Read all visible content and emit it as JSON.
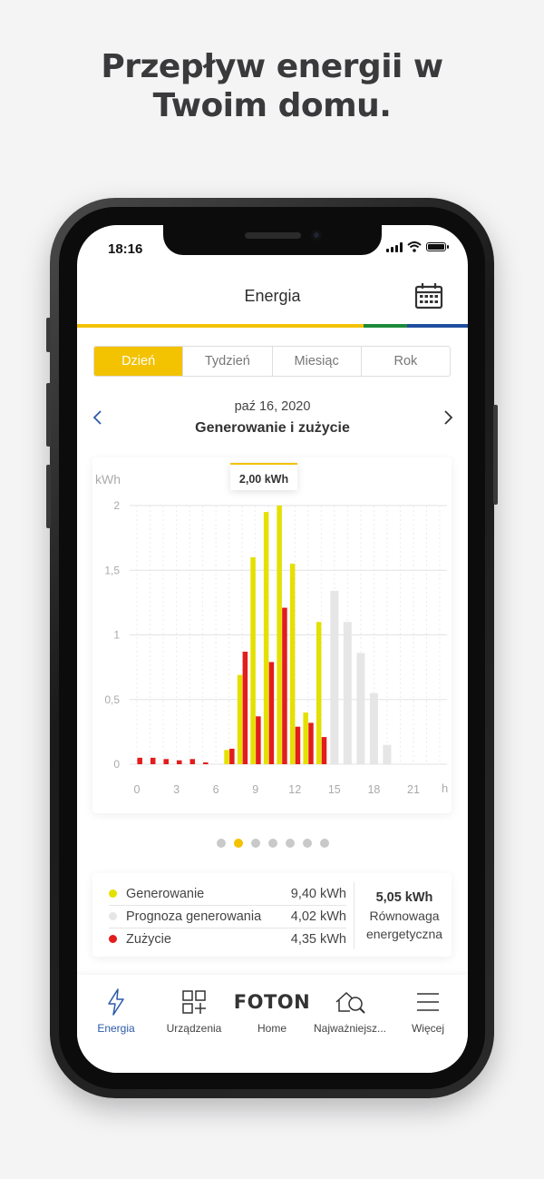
{
  "headline": {
    "line1": "Przepływ energii w",
    "line2": "Twoim domu."
  },
  "status": {
    "time": "18:16"
  },
  "header": {
    "title": "Energia",
    "calendar_icon": "calendar-icon"
  },
  "colors": {
    "accent": "#f3c200",
    "generation": "#e4e000",
    "forecast": "#e6e6e6",
    "consumption": "#e31c1c",
    "active_tab": "#2a5aa8"
  },
  "periods": [
    {
      "label": "Dzień",
      "selected": true
    },
    {
      "label": "Tydzień",
      "selected": false
    },
    {
      "label": "Miesiąc",
      "selected": false
    },
    {
      "label": "Rok",
      "selected": false
    }
  ],
  "day": {
    "date": "paź 16, 2020",
    "title": "Generowanie i zużycie"
  },
  "tooltip": {
    "value": "2,00 kWh"
  },
  "chart_data": {
    "type": "bar",
    "ylabel": "kWh",
    "xlabel": "h",
    "ylim": [
      0,
      2
    ],
    "xlim": [
      0,
      23
    ],
    "yticks": [
      "0",
      "0,5",
      "1",
      "1,5",
      "2"
    ],
    "xticks": [
      "0",
      "3",
      "6",
      "9",
      "12",
      "15",
      "18",
      "21"
    ],
    "grid": true,
    "series": [
      {
        "name": "Generowanie",
        "x": [
          7,
          8,
          9,
          10,
          11,
          12,
          13,
          14
        ],
        "values": [
          0.11,
          0.69,
          1.6,
          1.95,
          2.0,
          1.55,
          0.4,
          1.1
        ]
      },
      {
        "name": "Prognoza generowania",
        "x": [
          15,
          16,
          17,
          18,
          19
        ],
        "values": [
          1.34,
          1.1,
          0.86,
          0.55,
          0.15
        ]
      },
      {
        "name": "Zużycie",
        "x": [
          0,
          1,
          2,
          3,
          4,
          5,
          6,
          7,
          8,
          9,
          10,
          11,
          12,
          13,
          14
        ],
        "values": [
          0.05,
          0.05,
          0.04,
          0.03,
          0.04,
          0.01,
          0.0,
          0.12,
          0.87,
          0.37,
          0.79,
          1.21,
          0.29,
          0.32,
          0.21
        ]
      }
    ]
  },
  "pager": {
    "count": 7,
    "active": 1
  },
  "summary": {
    "rows": [
      {
        "label": "Generowanie",
        "value": "9,40 kWh",
        "color": "#e4e000"
      },
      {
        "label": "Prognoza generowania",
        "value": "4,02 kWh",
        "color": "#e6e6e6"
      },
      {
        "label": "Zużycie",
        "value": "4,35 kWh",
        "color": "#e31c1c"
      }
    ],
    "balance_value": "5,05 kWh",
    "balance_label1": "Równowaga",
    "balance_label2": "energetyczna"
  },
  "tabs": [
    {
      "label": "Energia",
      "icon": "lightning-icon",
      "active": true
    },
    {
      "label": "Urządzenia",
      "icon": "devices-grid-icon",
      "active": false
    },
    {
      "label": "Home",
      "icon": "foton-logo",
      "logo_text": "FOTON",
      "active": false
    },
    {
      "label": "Najważniejsz...",
      "icon": "house-search-icon",
      "active": false
    },
    {
      "label": "Więcej",
      "icon": "menu-icon",
      "active": false
    }
  ]
}
